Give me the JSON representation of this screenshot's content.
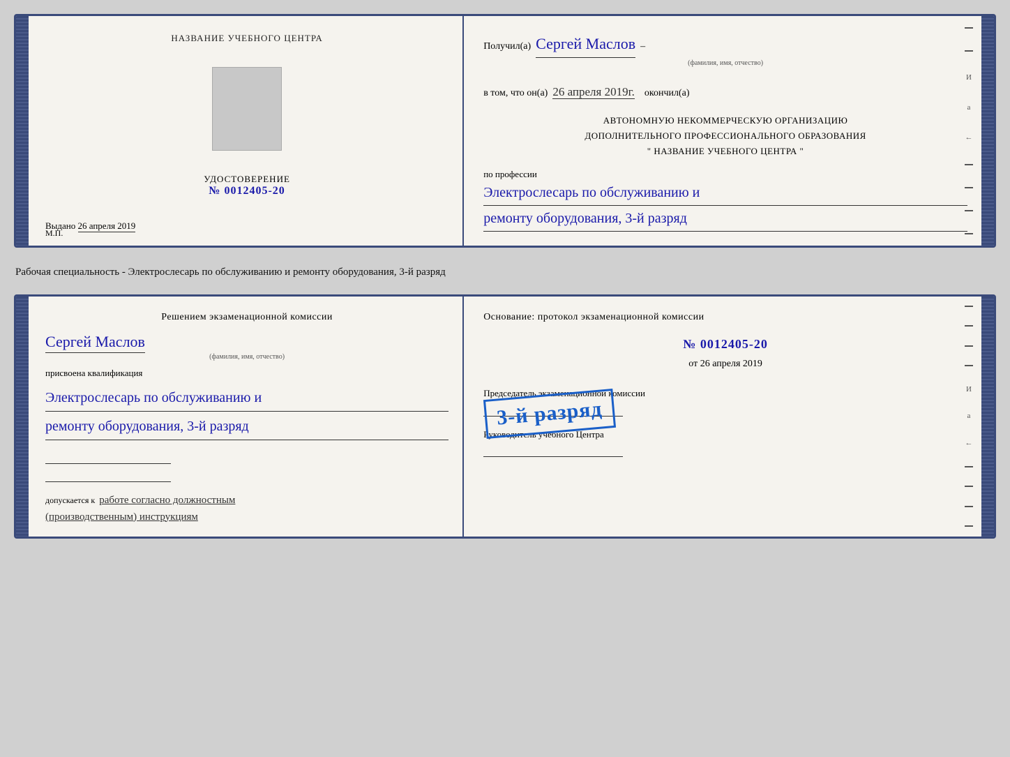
{
  "page": {
    "background": "#d0d0d0"
  },
  "between_text": "Рабочая специальность - Электрослесарь по обслуживанию и ремонту оборудования, 3-й разряд",
  "card1": {
    "left": {
      "org_name": "НАЗВАНИЕ УЧЕБНОГО ЦЕНТРА",
      "cert_label": "УДОСТОВЕРЕНИЕ",
      "cert_no_prefix": "№",
      "cert_number": "0012405-20",
      "issued_prefix": "Выдано",
      "issued_date": "26 апреля 2019",
      "mp_label": "М.П."
    },
    "right": {
      "received_prefix": "Получил(а)",
      "recipient_name": "Сергей Маслов",
      "fio_label": "(фамилия, имя, отчество)",
      "in_that_prefix": "в том, что он(а)",
      "completed_date": "26 апреля 2019г.",
      "completed_suffix": "окончил(а)",
      "org_line1": "АВТОНОМНУЮ НЕКОММЕРЧЕСКУЮ ОРГАНИЗАЦИЮ",
      "org_line2": "ДОПОЛНИТЕЛЬНОГО ПРОФЕССИОНАЛЬНОГО ОБРАЗОВАНИЯ",
      "org_line3": "\"  НАЗВАНИЕ УЧЕБНОГО ЦЕНТРА  \"",
      "profession_prefix": "по профессии",
      "profession_line1": "Электрослесарь по обслуживанию и",
      "profession_line2": "ремонту оборудования, 3-й разряд"
    }
  },
  "card2": {
    "left": {
      "decision_title": "Решением экзаменационной комиссии",
      "name": "Сергей Маслов",
      "fio_label": "(фамилия, имя, отчество)",
      "assigned_text": "присвоена квалификация",
      "qualification_line1": "Электрослесарь по обслуживанию и",
      "qualification_line2": "ремонту оборудования, 3-й разряд",
      "allowed_prefix": "допускается к",
      "allowed_text": "работе согласно должностным",
      "allowed_text2": "(производственным) инструкциям"
    },
    "right": {
      "basis_title": "Основание: протокол экзаменационной комиссии",
      "protocol_no_prefix": "№",
      "protocol_number": "0012405-20",
      "date_prefix": "от",
      "protocol_date": "26 апреля 2019",
      "chairman_label": "Председатель экзаменационной комиссии",
      "stamp_text": "3-й разряд",
      "head_label": "Руководитель учебного Центра"
    }
  },
  "deco": {
    "letters": [
      "И",
      "а",
      "←",
      "–",
      "–",
      "–",
      "–",
      "–"
    ]
  }
}
